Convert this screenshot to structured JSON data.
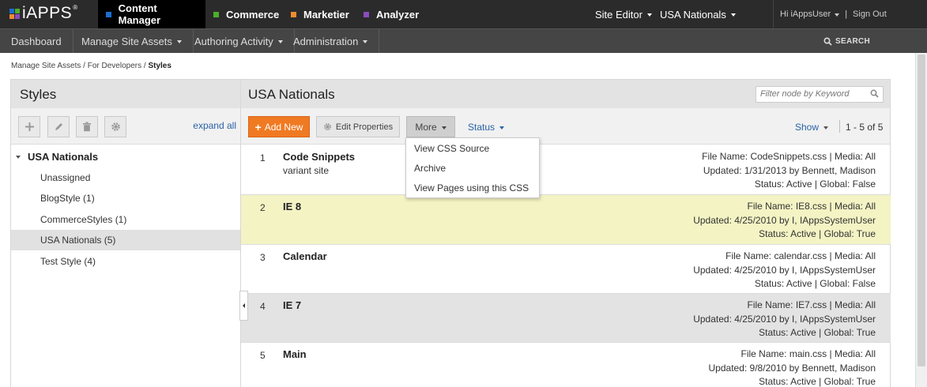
{
  "header": {
    "logo_text": "iAPPS",
    "logo_reg": "®",
    "products": [
      {
        "label": "Content Manager",
        "color": "#1a6fd0",
        "active": true
      },
      {
        "label": "Commerce",
        "color": "#4caf2a",
        "active": false
      },
      {
        "label": "Marketier",
        "color": "#f08a30",
        "active": false
      },
      {
        "label": "Analyzer",
        "color": "#8b4bbf",
        "active": false
      }
    ],
    "site_editor": "Site Editor",
    "site_name": "USA Nationals",
    "greeting": "Hi iAppsUser",
    "sign_out": "Sign Out",
    "separator": "|"
  },
  "nav": {
    "items": [
      {
        "label": "Dashboard",
        "has_caret": false
      },
      {
        "label": "Manage Site Assets",
        "has_caret": true
      },
      {
        "label": "Authoring Activity",
        "has_caret": true
      },
      {
        "label": "Administration",
        "has_caret": true
      }
    ],
    "search_label": "SEARCH"
  },
  "breadcrumb": {
    "items": [
      "Manage Site Assets",
      "For Developers"
    ],
    "current": "Styles",
    "separator": "/"
  },
  "left_panel": {
    "title": "Styles",
    "expand_all": "expand all",
    "tree_root": "USA Nationals",
    "tree_items": [
      {
        "label": "Unassigned",
        "selected": false
      },
      {
        "label": "BlogStyle (1)",
        "selected": false
      },
      {
        "label": "CommerceStyles (1)",
        "selected": false
      },
      {
        "label": "USA Nationals (5)",
        "selected": true
      },
      {
        "label": "Test Style (4)",
        "selected": false
      }
    ]
  },
  "right_panel": {
    "title": "USA Nationals",
    "filter_placeholder": "Filter node by Keyword",
    "add_new": "Add New",
    "edit_properties": "Edit Properties",
    "more": "More",
    "status": "Status",
    "show": "Show",
    "pager": "1 - 5 of 5",
    "more_menu": [
      "View CSS Source",
      "Archive",
      "View Pages using this CSS"
    ],
    "rows": [
      {
        "num": "1",
        "title": "Code Snippets",
        "subtitle": "variant site",
        "file": "File Name: CodeSnippets.css | Media: All",
        "updated": "Updated: 1/31/2013 by Bennett, Madison",
        "status": "Status: Active | Global: False",
        "style": "plain"
      },
      {
        "num": "2",
        "title": "IE 8",
        "subtitle": "",
        "file": "File Name: IE8.css | Media: All",
        "updated": "Updated: 4/25/2010 by I, IAppsSystemUser",
        "status": "Status: Active | Global: True",
        "style": "highlight"
      },
      {
        "num": "3",
        "title": "Calendar",
        "subtitle": "",
        "file": "File Name: calendar.css | Media: All",
        "updated": "Updated: 4/25/2010 by I, IAppsSystemUser",
        "status": "Status: Active | Global: False",
        "style": "plain"
      },
      {
        "num": "4",
        "title": "IE 7",
        "subtitle": "",
        "file": "File Name: IE7.css | Media: All",
        "updated": "Updated: 4/25/2010 by I, IAppsSystemUser",
        "status": "Status: Active | Global: True",
        "style": "gray"
      },
      {
        "num": "5",
        "title": "Main",
        "subtitle": "",
        "file": "File Name: main.css | Media: All",
        "updated": "Updated: 9/8/2010 by Bennett, Madison",
        "status": "Status: Active | Global: True",
        "style": "plain"
      }
    ]
  },
  "colors": {
    "topbar": "#2b2b2b",
    "navbar": "#454545",
    "accent_orange": "#f07a22",
    "link_blue": "#2a63a8",
    "row_highlight": "#f3f3c4"
  },
  "icons": {
    "add": "plus-icon",
    "edit": "pencil-icon",
    "delete": "trash-icon",
    "settings": "gear-icon",
    "search": "search-icon"
  }
}
